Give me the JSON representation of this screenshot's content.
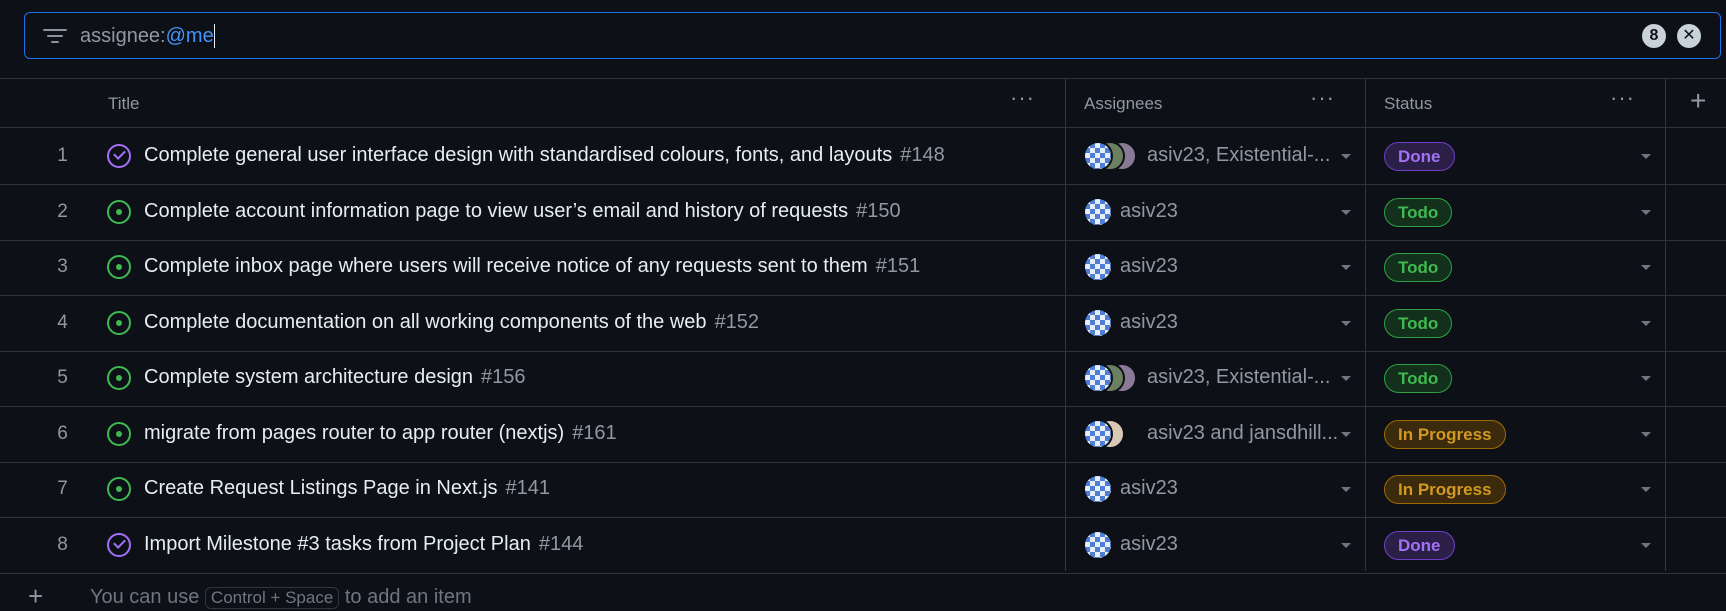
{
  "filter": {
    "key": "assignee:",
    "value": "@me",
    "count": "8",
    "clear_icon": "close-icon"
  },
  "columns": [
    {
      "label": "Title"
    },
    {
      "label": "Assignees"
    },
    {
      "label": "Status"
    }
  ],
  "more_glyph": "···",
  "add_column_glyph": "+",
  "rows": [
    {
      "n": "1",
      "state": "done",
      "title": "Complete general user interface design with standardised colours, fonts, and layouts",
      "num": "#148",
      "assignees": "asiv23, Existential-...",
      "avatars": 3,
      "status": "Done",
      "status_kind": "done"
    },
    {
      "n": "2",
      "state": "open",
      "title": "Complete account information page to view user’s email and history of requests",
      "num": "#150",
      "assignees": "asiv23",
      "avatars": 1,
      "status": "Todo",
      "status_kind": "todo"
    },
    {
      "n": "3",
      "state": "open",
      "title": "Complete inbox page where users will receive notice of any requests sent to them",
      "num": "#151",
      "assignees": "asiv23",
      "avatars": 1,
      "status": "Todo",
      "status_kind": "todo"
    },
    {
      "n": "4",
      "state": "open",
      "title": "Complete documentation on all working components of the web",
      "num": "#152",
      "assignees": "asiv23",
      "avatars": 1,
      "status": "Todo",
      "status_kind": "todo"
    },
    {
      "n": "5",
      "state": "open",
      "title": "Complete system architecture design",
      "num": "#156",
      "assignees": "asiv23, Existential-...",
      "avatars": 3,
      "status": "Todo",
      "status_kind": "todo"
    },
    {
      "n": "6",
      "state": "open",
      "title": "migrate from pages router to app router (nextjs)",
      "num": "#161",
      "assignees": "asiv23 and jansdhill...",
      "avatars": 2,
      "status": "In Progress",
      "status_kind": "prog"
    },
    {
      "n": "7",
      "state": "open",
      "title": "Create Request Listings Page in Next.js",
      "num": "#141",
      "assignees": "asiv23",
      "avatars": 1,
      "status": "In Progress",
      "status_kind": "prog"
    },
    {
      "n": "8",
      "state": "done",
      "title": "Import Milestone #3 tasks from Project Plan",
      "num": "#144",
      "assignees": "asiv23",
      "avatars": 1,
      "status": "Done",
      "status_kind": "done"
    }
  ],
  "footer": {
    "plus": "+",
    "before": "You can use ",
    "shortcut": "Control + Space",
    "after": " to add an item"
  }
}
